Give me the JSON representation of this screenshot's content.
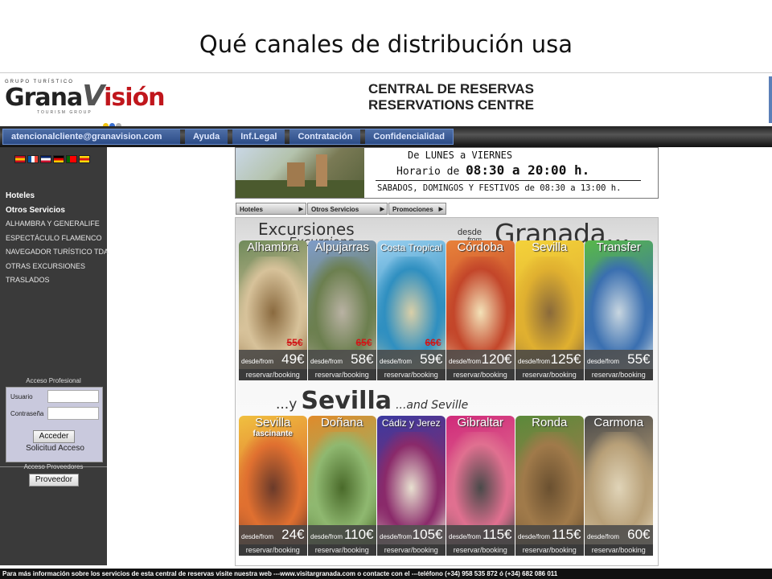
{
  "slide_title": "Qué canales de distribución usa",
  "header": {
    "logo_tag": "GRUPO TURÍSTICO",
    "logo_brand_a": "Grana",
    "logo_brand_v": "V",
    "logo_brand_b": "isión",
    "logo_sub": "TOURISM GROUP",
    "logo_dot_colors": [
      "#f2c40f",
      "#3a6fd0",
      "#b0b0b0"
    ],
    "central_line1": "CENTRAL DE RESERVAS",
    "central_line2": "RESERVATIONS CENTRE"
  },
  "topnav": [
    "atencionalcliente@granavision.com",
    "Ayuda",
    "Inf.Legal",
    "Contratación",
    "Confidencialidad"
  ],
  "sidebar": {
    "flags": [
      {
        "name": "spain-flag-icon",
        "colors": [
          "#c60b1e",
          "#ffc400",
          "#c60b1e"
        ]
      },
      {
        "name": "france-flag-icon",
        "colors": [
          "#0055a4",
          "#ffffff",
          "#ef4135"
        ]
      },
      {
        "name": "uk-flag-icon",
        "colors": [
          "#012169",
          "#ffffff",
          "#c8102e"
        ]
      },
      {
        "name": "germany-flag-icon",
        "colors": [
          "#000000",
          "#dd0000",
          "#ffce00"
        ]
      },
      {
        "name": "portugal-flag-icon",
        "colors": [
          "#006600",
          "#ff0000",
          "#ff0000"
        ]
      },
      {
        "name": "catalonia-flag-icon",
        "colors": [
          "#fcdd09",
          "#da121a",
          "#fcdd09"
        ]
      }
    ],
    "menu": [
      "Hoteles",
      "Otros Servicios",
      "ALHAMBRA Y GENERALIFE",
      "ESPECTÁCULO FLAMENCO",
      "NAVEGADOR TURÍSTICO TDA",
      "OTRAS EXCURSIONES",
      "TRASLADOS"
    ],
    "acceso_profesional": "Acceso Profesional",
    "usuario_label": "Usuario",
    "contrasena_label": "Contraseña",
    "acceder": "Acceder",
    "solicitud": "Solicitud Acceso",
    "acceso_proveedores": "Acceso Proveedores",
    "proveedor": "Proveedor"
  },
  "schedule": {
    "line1": "De LUNES a VIERNES",
    "line2_a": "Horario de ",
    "line2_b": "08:30 a 20:00 h.",
    "line3": "SABADOS, DOMINGOS Y FESTIVOS de 08:30 a 13:00 h."
  },
  "subnav": [
    "Hoteles",
    "Otros Servicios",
    "Promociones"
  ],
  "panel": {
    "excursiones": "Excursiones",
    "excursions": "Excursions",
    "desde": "desde",
    "from": "from",
    "granada": "Granada...",
    "y": "...y",
    "sevilla": "Sevilla",
    "and_seville": "...and Seville",
    "desde_from": "desde/from",
    "booking": "reservar/booking",
    "row1": [
      {
        "name": "Alhambra",
        "old": "55€",
        "price": "49€",
        "colors": [
          "#6f8a5a",
          "#d7c29a",
          "#8a6a3f"
        ]
      },
      {
        "name": "Alpujarras",
        "old": "65€",
        "price": "58€",
        "colors": [
          "#7f9cc9",
          "#6c7f4f",
          "#b9b2a3"
        ]
      },
      {
        "name": "Costa Tropical",
        "old": "66€",
        "price": "59€",
        "colors": [
          "#9ad0f0",
          "#2f8fc0",
          "#d9cfa8"
        ]
      },
      {
        "name": "Córdoba",
        "old": "",
        "price": "120€",
        "colors": [
          "#e8823a",
          "#c3462a",
          "#f3e2b8"
        ]
      },
      {
        "name": "Sevilla",
        "old": "",
        "price": "125€",
        "colors": [
          "#f4d23a",
          "#e0b030",
          "#8a6a3a"
        ]
      },
      {
        "name": "Transfer",
        "old": "",
        "price": "55€",
        "colors": [
          "#58b848",
          "#3a6fb0",
          "#c8d6e0"
        ]
      }
    ],
    "row2": [
      {
        "name": "Sevilla",
        "sub": "fascinante",
        "price": "24€",
        "colors": [
          "#f0c040",
          "#e07030",
          "#6a3a2a"
        ]
      },
      {
        "name": "Doñana",
        "sub": "",
        "price": "110€",
        "colors": [
          "#e08a2a",
          "#8fb870",
          "#4a6a2a"
        ]
      },
      {
        "name": "Cádiz y Jerez",
        "sub": "",
        "price": "105€",
        "colors": [
          "#3a3aa0",
          "#8a2a6a",
          "#e8e0d0"
        ]
      },
      {
        "name": "Gibraltar",
        "sub": "",
        "price": "115€",
        "colors": [
          "#d02a7a",
          "#e07090",
          "#4a4a4a"
        ]
      },
      {
        "name": "Ronda",
        "sub": "",
        "price": "115€",
        "colors": [
          "#5a8a3a",
          "#a07a4a",
          "#6a5030"
        ]
      },
      {
        "name": "Carmona",
        "sub": "",
        "price": "60€",
        "colors": [
          "#4a4a4a",
          "#b8a078",
          "#e0d4b8"
        ]
      }
    ]
  },
  "footer": "Para más información sobre los servicios de esta central de reservas visite nuestra web ---www.visitargranada.com o contacte con el ---teléfono (+34) 958 535 872 ó (+34) 682 086 011"
}
